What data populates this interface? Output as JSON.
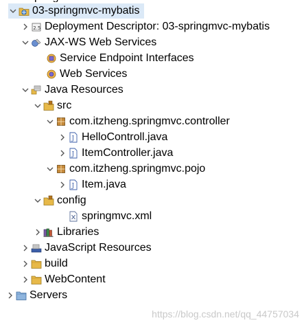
{
  "tree": {
    "partial_top_label": "springmvc",
    "items": [
      {
        "label": "03-springmvc-mybatis"
      },
      {
        "label": "Deployment Descriptor: 03-springmvc-mybatis"
      },
      {
        "label": "JAX-WS Web Services"
      },
      {
        "label": "Service Endpoint Interfaces"
      },
      {
        "label": "Web Services"
      },
      {
        "label": "Java Resources"
      },
      {
        "label": "src"
      },
      {
        "label": "com.itzheng.springmvc.controller"
      },
      {
        "label": "HelloControll.java"
      },
      {
        "label": "ItemController.java"
      },
      {
        "label": "com.itzheng.springmvc.pojo"
      },
      {
        "label": "Item.java"
      },
      {
        "label": "config"
      },
      {
        "label": "springmvc.xml"
      },
      {
        "label": "Libraries"
      },
      {
        "label": "JavaScript Resources"
      },
      {
        "label": "build"
      },
      {
        "label": "WebContent"
      },
      {
        "label": "Servers"
      }
    ]
  },
  "watermark": "https://blog.csdn.net/qq_44757034",
  "colors": {
    "selection": "#dbe9f7",
    "folder": "#e7b949",
    "package": "#b5751c",
    "java": "#3b5ea8"
  }
}
